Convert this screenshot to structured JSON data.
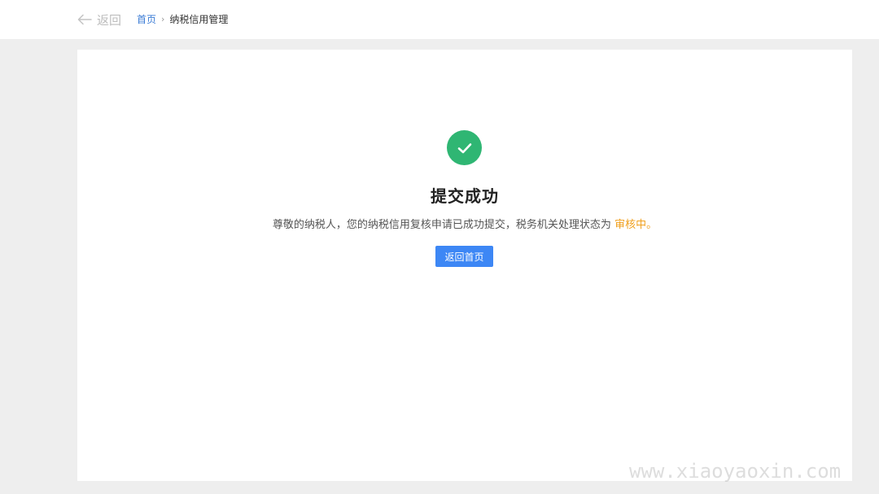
{
  "header": {
    "back_label": "返回",
    "breadcrumb": {
      "home": "首页",
      "current": "纳税信用管理"
    }
  },
  "result": {
    "icon": "check-circle-icon",
    "title": "提交成功",
    "message_prefix": "尊敬的纳税人，您的纳税信用复核申请已成功提交，税务机关处理状态为",
    "status_text": "审核中。",
    "home_button_label": "返回首页"
  },
  "watermark": "www.xiaoyaoxin.com",
  "colors": {
    "accent": "#3d87f5",
    "success": "#2fb673",
    "status": "#f0a01e"
  }
}
